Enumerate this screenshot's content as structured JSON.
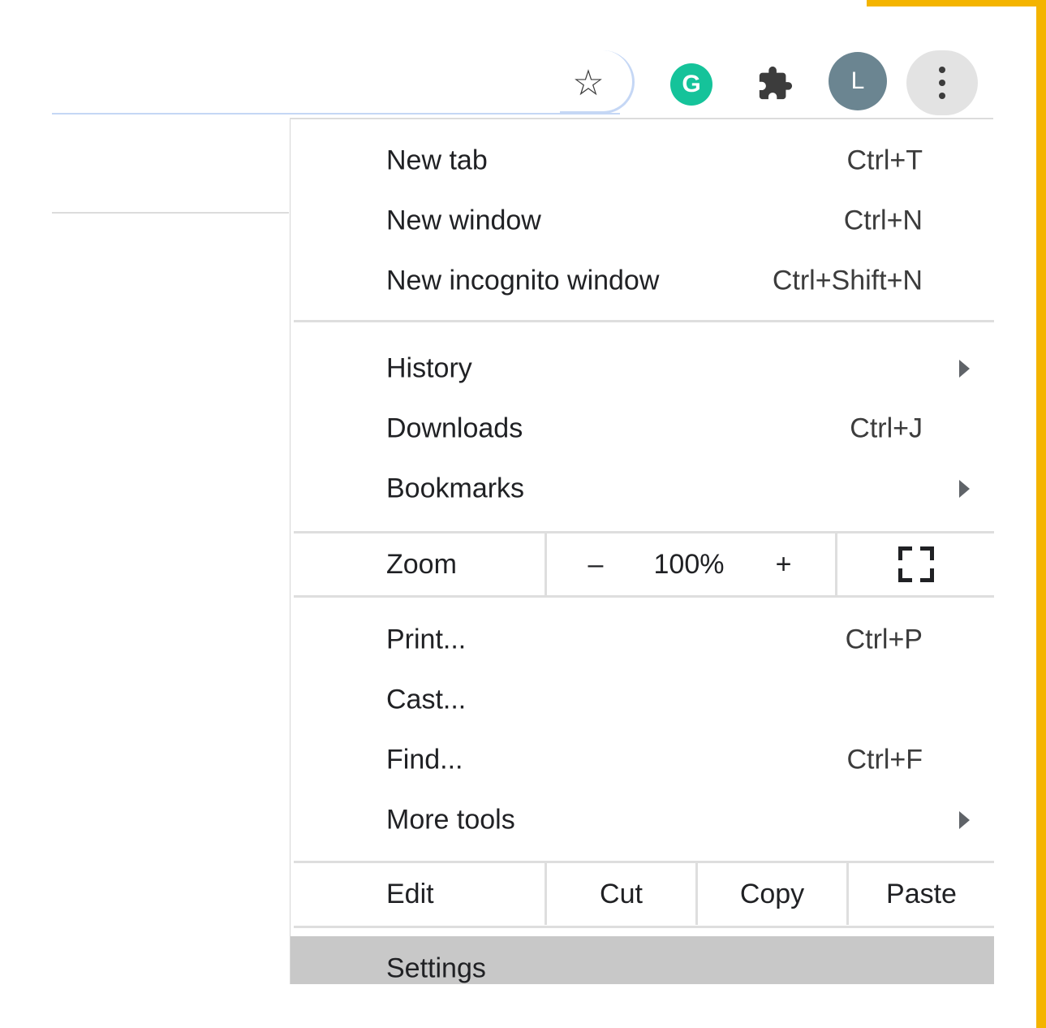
{
  "toolbar": {
    "bookmark_icon": "star-icon",
    "grammarly_letter": "G",
    "extensions_icon": "puzzle-icon",
    "avatar_letter": "L",
    "menu_icon": "vertical-dots-icon"
  },
  "menu": {
    "group1": [
      {
        "label": "New tab",
        "shortcut": "Ctrl+T"
      },
      {
        "label": "New window",
        "shortcut": "Ctrl+N"
      },
      {
        "label": "New incognito window",
        "shortcut": "Ctrl+Shift+N"
      }
    ],
    "group2": [
      {
        "label": "History",
        "shortcut": ""
      },
      {
        "label": "Downloads",
        "shortcut": "Ctrl+J"
      },
      {
        "label": "Bookmarks",
        "shortcut": ""
      }
    ],
    "zoom": {
      "label": "Zoom",
      "minus": "–",
      "level": "100%",
      "plus": "+",
      "fullscreen_icon": "fullscreen-icon"
    },
    "group3": [
      {
        "label": "Print...",
        "shortcut": "Ctrl+P"
      },
      {
        "label": "Cast...",
        "shortcut": ""
      },
      {
        "label": "Find...",
        "shortcut": "Ctrl+F"
      },
      {
        "label": "More tools",
        "shortcut": ""
      }
    ],
    "edit": {
      "label": "Edit",
      "cut": "Cut",
      "copy": "Copy",
      "paste": "Paste"
    },
    "settings": {
      "label": "Settings"
    }
  },
  "colors": {
    "highlight_frame": "#f4b400",
    "grammarly": "#15c39a",
    "avatar": "#6b8591",
    "settings_hover": "#c8c8c8"
  }
}
